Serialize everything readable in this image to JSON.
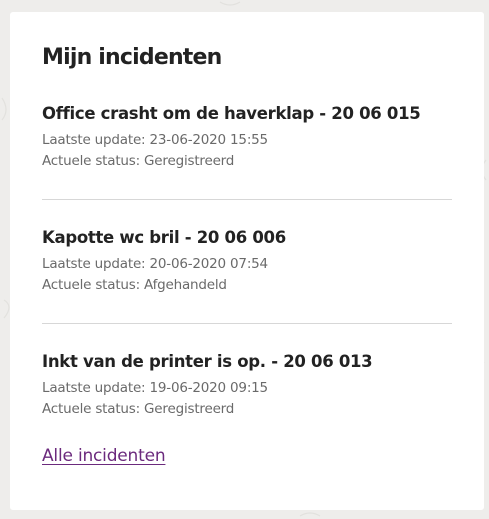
{
  "card": {
    "title": "Mijn incidenten",
    "incidents": [
      {
        "title": "Office crasht om de haverklap - 20 06 015",
        "last_update": "Laatste update: 23-06-2020 15:55",
        "status": "Actuele status: Geregistreerd"
      },
      {
        "title": "Kapotte wc bril - 20 06 006",
        "last_update": "Laatste update: 20-06-2020 07:54",
        "status": "Actuele status: Afgehandeld"
      },
      {
        "title": "Inkt van de printer is op. - 20 06 013",
        "last_update": "Laatste update: 19-06-2020 09:15",
        "status": "Actuele status: Geregistreerd"
      }
    ],
    "all_link": "Alle incidenten"
  },
  "colors": {
    "background": "#eeedeb",
    "card": "#ffffff",
    "link": "#6b2a7d",
    "title_text": "#222222",
    "meta_text": "#6a6a6a",
    "divider": "#d7d7d7"
  }
}
